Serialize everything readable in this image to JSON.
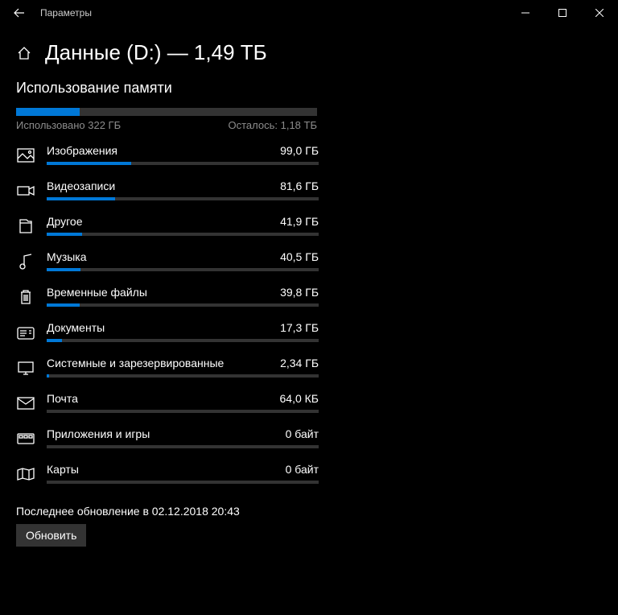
{
  "window": {
    "title": "Параметры"
  },
  "header": {
    "title": "Данные (D:) — 1,49 ТБ"
  },
  "usage": {
    "section_title": "Использование памяти",
    "used_label": "Использовано 322 ГБ",
    "free_label": "Осталось: 1,18 ТБ",
    "pct": 21
  },
  "categories": [
    {
      "icon": "image",
      "label": "Изображения",
      "size": "99,0 ГБ",
      "pct": 31
    },
    {
      "icon": "video",
      "label": "Видеозаписи",
      "size": "81,6 ГБ",
      "pct": 25
    },
    {
      "icon": "folder",
      "label": "Другое",
      "size": "41,9 ГБ",
      "pct": 13
    },
    {
      "icon": "music",
      "label": "Музыка",
      "size": "40,5 ГБ",
      "pct": 12.5
    },
    {
      "icon": "trash",
      "label": "Временные файлы",
      "size": "39,8 ГБ",
      "pct": 12
    },
    {
      "icon": "document",
      "label": "Документы",
      "size": "17,3 ГБ",
      "pct": 5.5
    },
    {
      "icon": "system",
      "label": "Системные и зарезервированные",
      "size": "2,34 ГБ",
      "pct": 1
    },
    {
      "icon": "mail",
      "label": "Почта",
      "size": "64,0 КБ",
      "pct": 0
    },
    {
      "icon": "apps",
      "label": "Приложения и игры",
      "size": "0 байт",
      "pct": 0
    },
    {
      "icon": "maps",
      "label": "Карты",
      "size": "0 байт",
      "pct": 0
    }
  ],
  "footer": {
    "last_update": "Последнее обновление в 02.12.2018 20:43",
    "refresh": "Обновить"
  }
}
